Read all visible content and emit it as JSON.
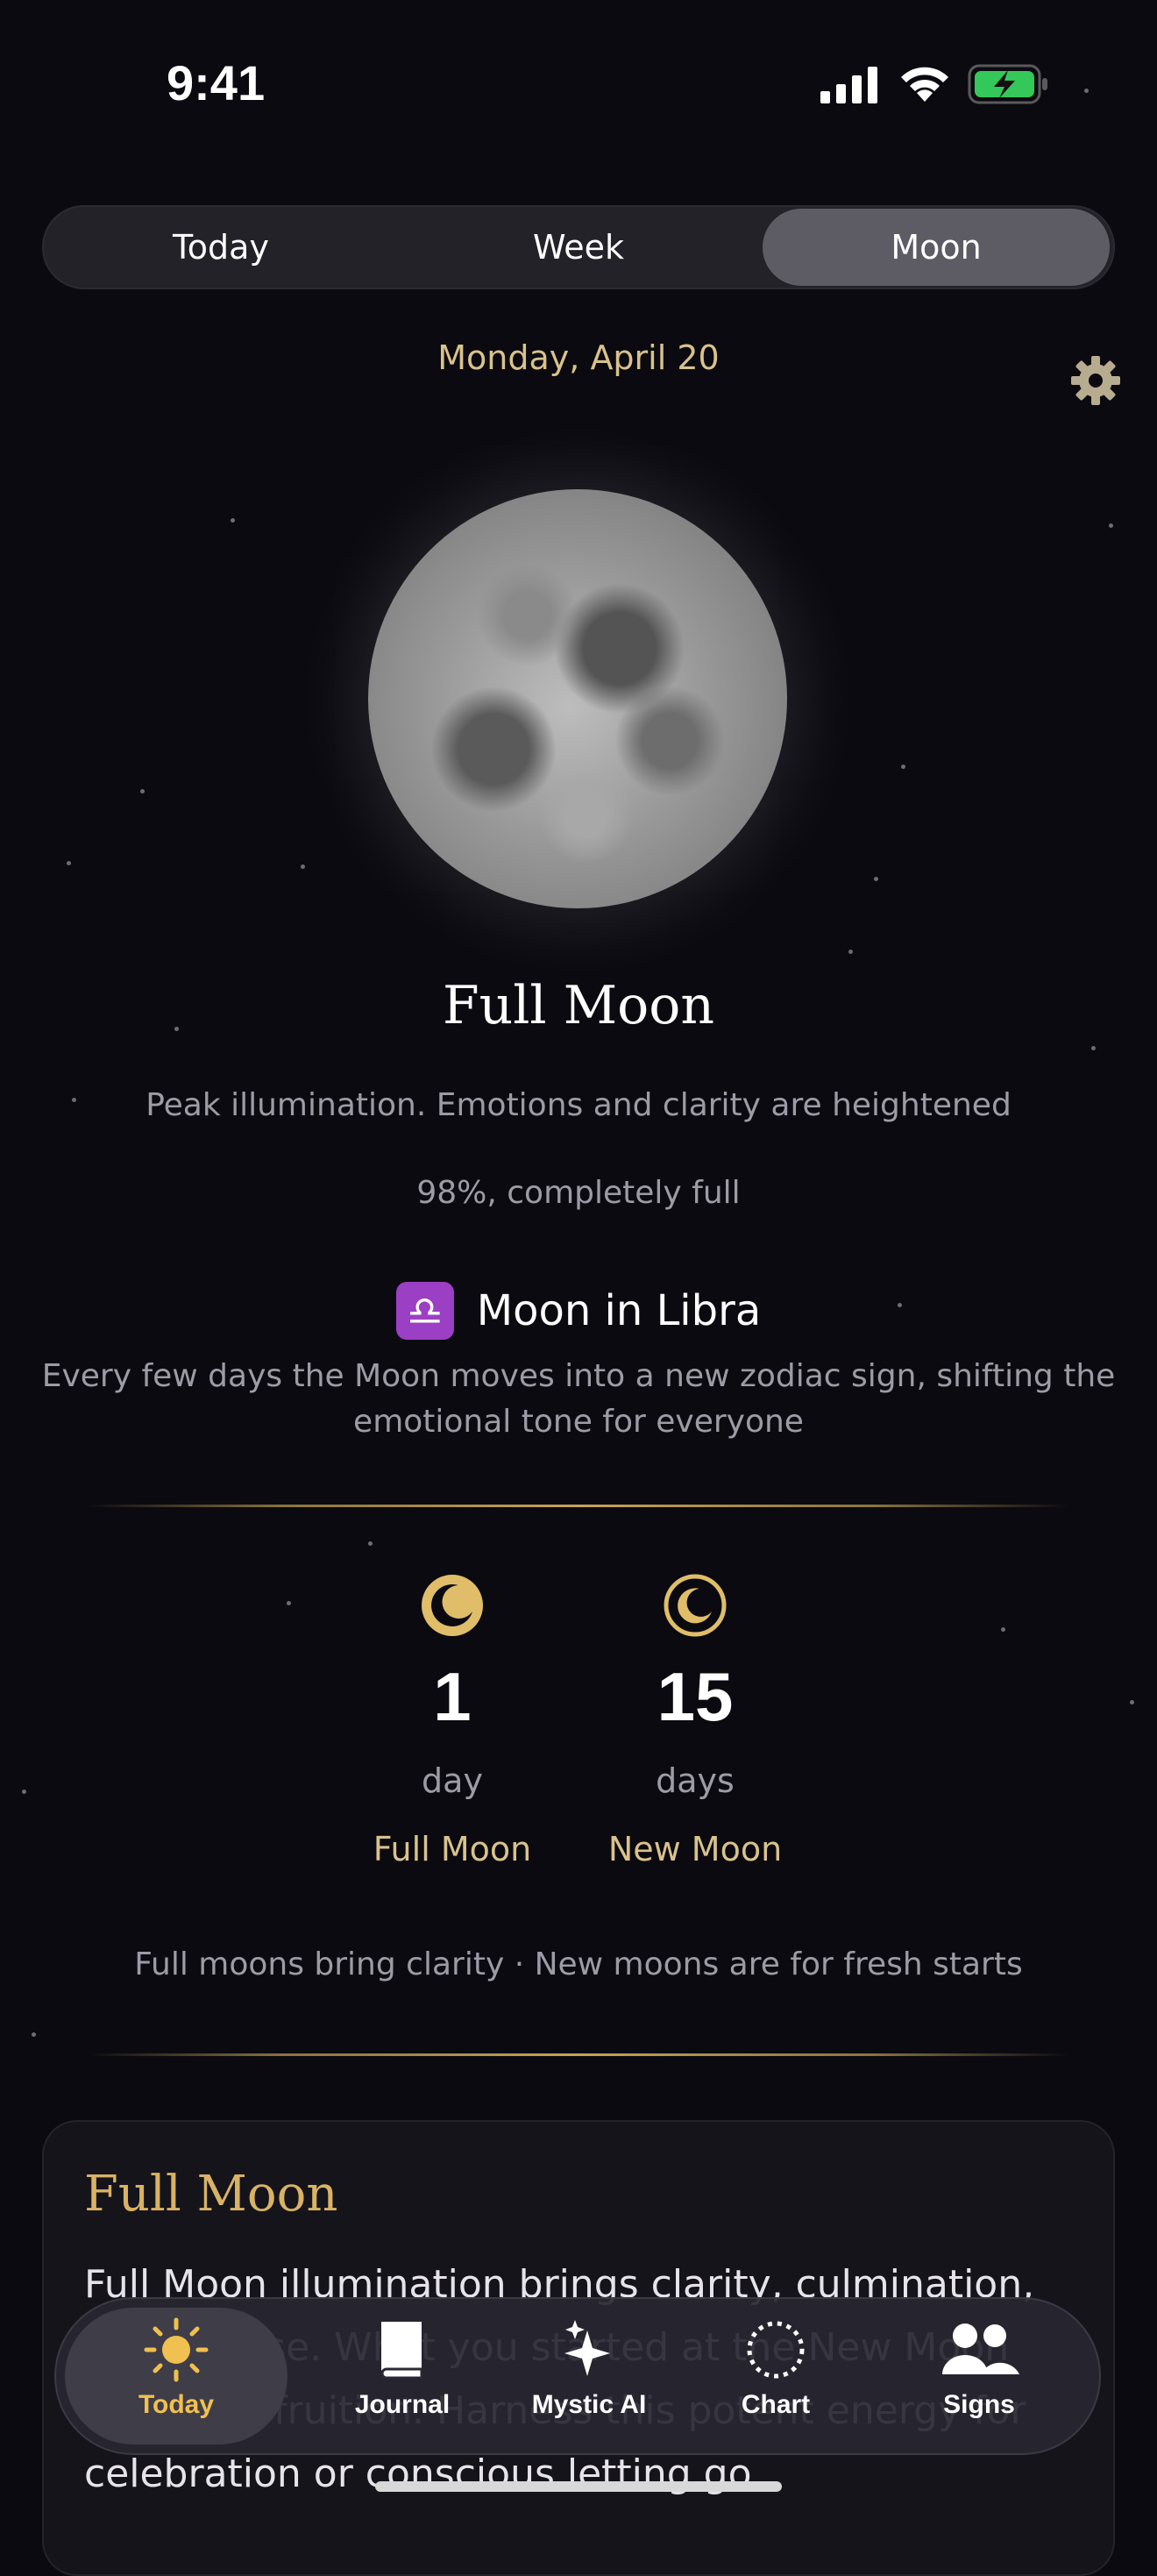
{
  "status_bar": {
    "time": "9:41"
  },
  "segments": [
    {
      "label": "Today",
      "active": false
    },
    {
      "label": "Week",
      "active": false
    },
    {
      "label": "Moon",
      "active": true
    }
  ],
  "date": "Monday, April 20",
  "moon_phase": {
    "title": "Full Moon",
    "description": "Peak illumination. Emotions and clarity are heightened",
    "illumination": "98%, completely full"
  },
  "moon_sign": {
    "symbol": "♎",
    "label": "Moon in Libra",
    "description": "Every few days the Moon moves into a new zodiac sign, shifting the emotional tone for everyone"
  },
  "countdowns": [
    {
      "number": "1",
      "unit": "day",
      "label": "Full Moon",
      "icon": "full-moon-icon"
    },
    {
      "number": "15",
      "unit": "days",
      "label": "New Moon",
      "icon": "new-moon-icon"
    }
  ],
  "tips": "Full moons bring clarity · New moons are for fresh starts",
  "card": {
    "title": "Full Moon",
    "body": "Full Moon illumination brings clarity, culmination, and release. What you started at the New Moon comes to fruition. Harness this potent energy for celebration or conscious letting go."
  },
  "tabbar": [
    {
      "label": "Today",
      "icon": "sun-icon",
      "active": true
    },
    {
      "label": "Journal",
      "icon": "book-icon",
      "active": false
    },
    {
      "label": "Mystic AI",
      "icon": "sparkles-icon",
      "active": false
    },
    {
      "label": "Chart",
      "icon": "chart-circle-icon",
      "active": false
    },
    {
      "label": "Signs",
      "icon": "people-icon",
      "active": false
    }
  ],
  "colors": {
    "accent_gold": "#d9c28c",
    "card_title": "#d9b266",
    "battery": "#34c759",
    "libra_badge": "#9b3fc4"
  }
}
